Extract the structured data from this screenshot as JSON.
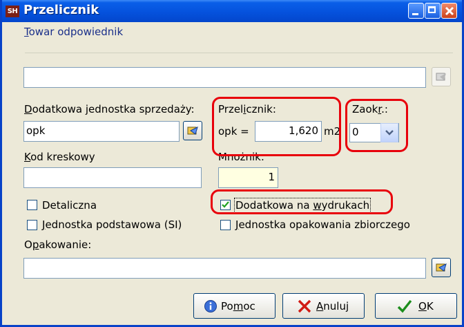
{
  "window": {
    "title": "Przelicznik",
    "app_icon_text": "SH"
  },
  "group": {
    "label": "Towar odpowiednik",
    "label_mnemonic": "T",
    "label_rest": "owar odpowiednik",
    "value": ""
  },
  "unit": {
    "label": "Dodatkowa jednostka sprzedaży:",
    "label_mnemonic": "D",
    "label_rest": "odatkowa jednostka sprzedaży:",
    "value": "opk"
  },
  "converter": {
    "label": "Przelicznik:",
    "label_a": "Przel",
    "label_mnemonic": "i",
    "label_b": "cznik:",
    "prefix": "opk =",
    "value": "1,620",
    "unit": "m2"
  },
  "rounding": {
    "label": "Zaokr.:",
    "label_a": "Zaok",
    "label_mnemonic": "r",
    "label_b": ".:",
    "value": "0"
  },
  "barcode": {
    "label": "Kod kreskowy",
    "label_mnemonic": "K",
    "label_rest": "od kreskowy",
    "value": ""
  },
  "multiplier": {
    "label": "Mnożnik:",
    "value": "1"
  },
  "checkboxes": {
    "retail": {
      "label": "Detaliczna",
      "checked": false
    },
    "print": {
      "label": "Dodatkowa na wydrukach",
      "label_a": "Dodatkowa na ",
      "label_mnemonic": "w",
      "label_b": "ydrukach",
      "checked": true
    },
    "base_unit": {
      "label": "Jednostka podstawowa (SI)",
      "label_mnemonic": "J",
      "label_rest": "ednostka podstawowa (SI)",
      "checked": false
    },
    "bulk_unit": {
      "label": "Jednostka opakowania zbiorczego",
      "label_mnemonic": "J",
      "label_rest": "ednostka opakowania zbiorczego",
      "checked": false
    }
  },
  "packaging": {
    "label": "Opakowanie:",
    "label_a": "O",
    "label_mnemonic": "p",
    "label_b": "akowanie:",
    "value": ""
  },
  "buttons": {
    "help": {
      "label": "Pomoc",
      "label_a": "Po",
      "label_mnemonic": "m",
      "label_b": "oc"
    },
    "cancel": {
      "label": "Anuluj",
      "label_mnemonic": "A",
      "label_rest": "nuluj"
    },
    "ok": {
      "label": "OK",
      "label_mnemonic": "O",
      "label_rest": "K"
    }
  },
  "colors": {
    "titlebar": "#0552dd",
    "highlight": "#e8000b",
    "dialog_bg": "#ece9d8",
    "yellow_field": "#ffffe1"
  },
  "icons": [
    "app-icon",
    "lookup-icon",
    "dropdown-arrow-icon",
    "checkmark-icon",
    "info-icon",
    "cancel-x-icon",
    "ok-check-icon"
  ]
}
